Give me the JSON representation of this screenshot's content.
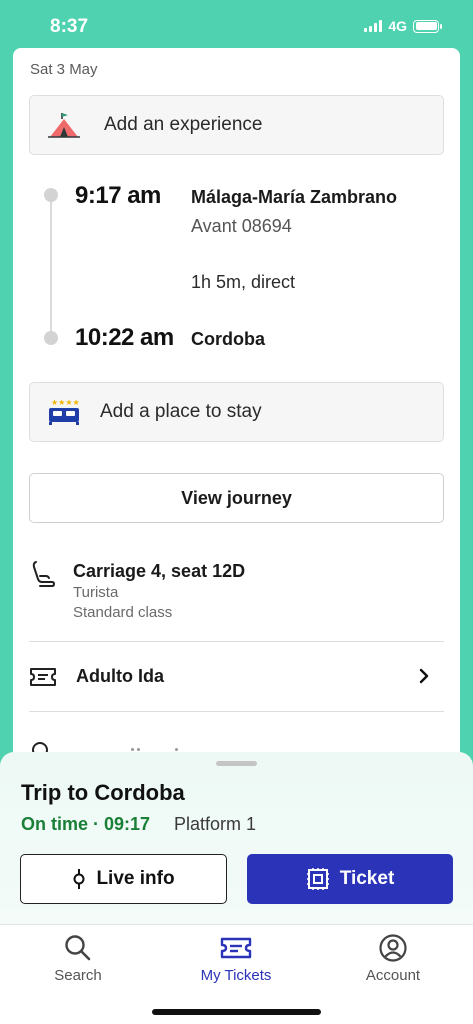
{
  "status": {
    "time": "8:37",
    "network": "4G"
  },
  "itinerary": {
    "date": "Sat 3 May",
    "add_experience": "Add an experience",
    "departure": {
      "time": "9:17 am",
      "station": "Málaga-María Zambrano",
      "train": "Avant 08694"
    },
    "duration": "1h 5m, direct",
    "arrival": {
      "time": "10:22 am",
      "station": "Cordoba"
    },
    "add_stay": "Add a place to stay",
    "view_journey": "View journey"
  },
  "seat": {
    "title": "Carriage 4, seat 12D",
    "fare_type": "Turista",
    "class": "Standard class"
  },
  "fare": {
    "label": "Adulto Ida"
  },
  "sheet": {
    "title": "Trip to Cordoba",
    "status": "On time · 09:17",
    "platform": "Platform 1",
    "live_info": "Live info",
    "ticket": "Ticket"
  },
  "tabs": [
    {
      "label": "Search",
      "icon": "search-icon"
    },
    {
      "label": "My Tickets",
      "icon": "ticket-icon"
    },
    {
      "label": "Account",
      "icon": "account-icon"
    }
  ],
  "colors": {
    "brand_mint": "#4fd2b0",
    "primary_blue": "#2b34b8",
    "on_time_green": "#1a7f37"
  }
}
